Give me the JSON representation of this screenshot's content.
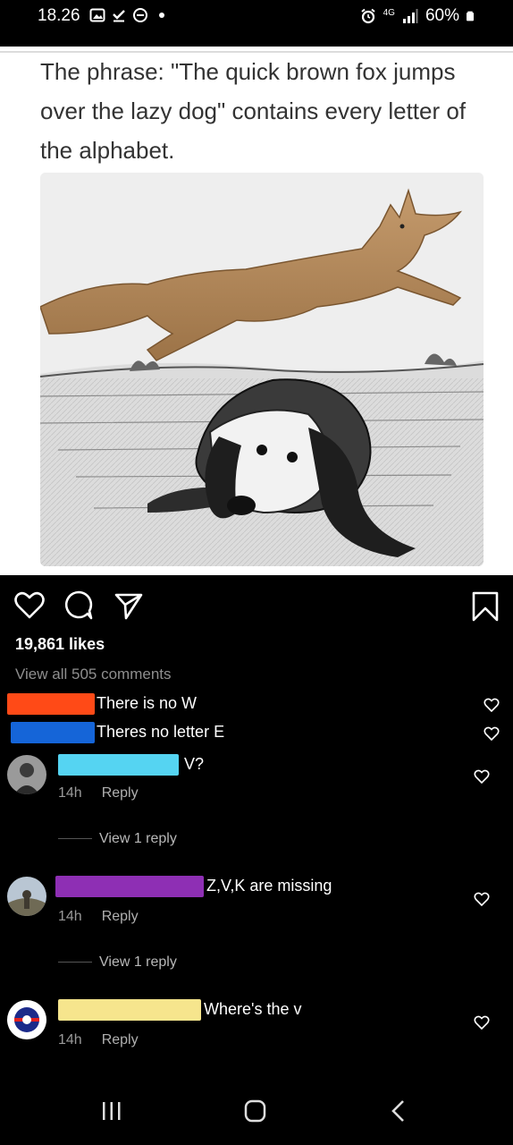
{
  "status": {
    "time": "18.26",
    "network": "4G",
    "battery": "60%"
  },
  "post": {
    "caption": "The phrase: \"The quick brown fox jumps over the lazy dog\" contains every letter of the alphabet.",
    "likes": "19,861 likes",
    "view_all": "View all 505 comments"
  },
  "comments": [
    {
      "text": "There is no W",
      "redact_color": "#ff4a17"
    },
    {
      "text": "Theres no letter E",
      "redact_color": "#1565d8"
    },
    {
      "text": "V?",
      "redact_color": "#55d4f2",
      "time": "14h",
      "reply": "Reply",
      "view_replies": "View 1 reply"
    },
    {
      "text": "Z,V,K are missing",
      "redact_color": "#8e2fb4",
      "time": "14h",
      "reply": "Reply",
      "view_replies": "View 1 reply"
    },
    {
      "text": "Where's the v",
      "redact_color": "#f6e58d",
      "time": "14h",
      "reply": "Reply"
    }
  ]
}
